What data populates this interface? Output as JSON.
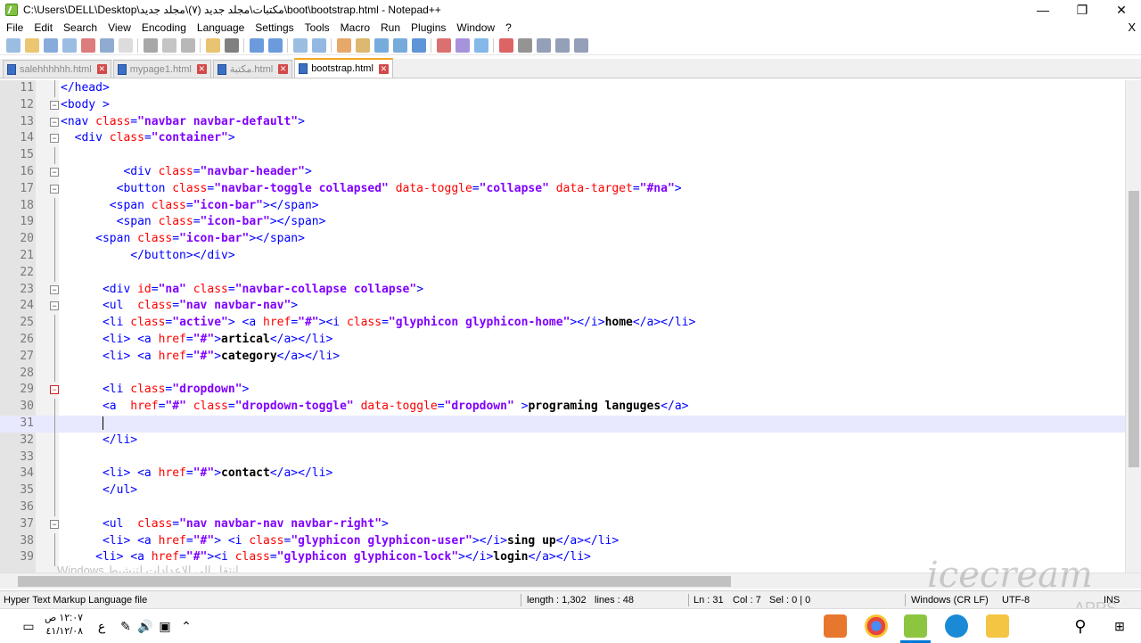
{
  "window": {
    "title": "C:\\Users\\DELL\\Desktop\\مكتبات\\مجلد جديد (٧)\\مجلد جديد\\boot\\bootstrap.html - Notepad++",
    "minimize": "—",
    "maximize": "❐",
    "close": "✕"
  },
  "menu": {
    "items": [
      "File",
      "Edit",
      "Search",
      "View",
      "Encoding",
      "Language",
      "Settings",
      "Tools",
      "Macro",
      "Run",
      "Plugins",
      "Window",
      "?"
    ],
    "close": "X"
  },
  "tabs": [
    {
      "label": "salehhhhhh.html",
      "active": false
    },
    {
      "label": "mypage1.html",
      "active": false
    },
    {
      "label": "مكتبة.html",
      "active": false
    },
    {
      "label": "bootstrap.html",
      "active": true
    }
  ],
  "tab_close": "✕",
  "editor": {
    "lines": [
      {
        "n": "11",
        "fold": "",
        "tokens": [
          [
            "tag",
            "</head>"
          ]
        ]
      },
      {
        "n": "12",
        "fold": "minus",
        "tokens": [
          [
            "tag",
            "<body >"
          ]
        ]
      },
      {
        "n": "13",
        "fold": "minus",
        "tokens": [
          [
            "tag",
            "<nav "
          ],
          [
            "attr",
            "class"
          ],
          [
            "tag",
            "="
          ],
          [
            "str",
            "\"navbar navbar-default\""
          ],
          [
            "tag",
            ">"
          ]
        ]
      },
      {
        "n": "14",
        "fold": "minus",
        "tokens": [
          [
            "tag",
            "  <div "
          ],
          [
            "attr",
            "class"
          ],
          [
            "tag",
            "="
          ],
          [
            "str",
            "\"container\""
          ],
          [
            "tag",
            ">"
          ]
        ]
      },
      {
        "n": "15",
        "fold": "",
        "tokens": []
      },
      {
        "n": "16",
        "fold": "minus",
        "tokens": [
          [
            "tag",
            "         <div "
          ],
          [
            "attr",
            "class"
          ],
          [
            "tag",
            "="
          ],
          [
            "str",
            "\"navbar-header\""
          ],
          [
            "tag",
            ">"
          ]
        ]
      },
      {
        "n": "17",
        "fold": "minus",
        "tokens": [
          [
            "tag",
            "        <button "
          ],
          [
            "attr",
            "class"
          ],
          [
            "tag",
            "="
          ],
          [
            "str",
            "\"navbar-toggle collapsed\""
          ],
          [
            "tag",
            " "
          ],
          [
            "attr",
            "data-toggle"
          ],
          [
            "tag",
            "="
          ],
          [
            "str",
            "\"collapse\""
          ],
          [
            "tag",
            " "
          ],
          [
            "attr",
            "data-target"
          ],
          [
            "tag",
            "="
          ],
          [
            "str",
            "\"#na\""
          ],
          [
            "tag",
            ">"
          ]
        ]
      },
      {
        "n": "18",
        "fold": "",
        "tokens": [
          [
            "tag",
            "       <span "
          ],
          [
            "attr",
            "class"
          ],
          [
            "tag",
            "="
          ],
          [
            "str",
            "\"icon-bar\""
          ],
          [
            "tag",
            "></span>"
          ]
        ]
      },
      {
        "n": "19",
        "fold": "",
        "tokens": [
          [
            "tag",
            "        <span "
          ],
          [
            "attr",
            "class"
          ],
          [
            "tag",
            "="
          ],
          [
            "str",
            "\"icon-bar\""
          ],
          [
            "tag",
            "></span>"
          ]
        ]
      },
      {
        "n": "20",
        "fold": "",
        "tokens": [
          [
            "tag",
            "     <span "
          ],
          [
            "attr",
            "class"
          ],
          [
            "tag",
            "="
          ],
          [
            "str",
            "\"icon-bar\""
          ],
          [
            "tag",
            "></span>"
          ]
        ]
      },
      {
        "n": "21",
        "fold": "",
        "tokens": [
          [
            "tag",
            "          </button></div>"
          ]
        ]
      },
      {
        "n": "22",
        "fold": "",
        "tokens": []
      },
      {
        "n": "23",
        "fold": "minus",
        "tokens": [
          [
            "tag",
            "      <div "
          ],
          [
            "attr",
            "id"
          ],
          [
            "tag",
            "="
          ],
          [
            "str",
            "\"na\""
          ],
          [
            "tag",
            " "
          ],
          [
            "attr",
            "class"
          ],
          [
            "tag",
            "="
          ],
          [
            "str",
            "\"navbar-collapse collapse\""
          ],
          [
            "tag",
            ">"
          ]
        ]
      },
      {
        "n": "24",
        "fold": "minus",
        "tokens": [
          [
            "tag",
            "      <ul  "
          ],
          [
            "attr",
            "class"
          ],
          [
            "tag",
            "="
          ],
          [
            "str",
            "\"nav navbar-nav\""
          ],
          [
            "tag",
            ">"
          ]
        ]
      },
      {
        "n": "25",
        "fold": "",
        "tokens": [
          [
            "tag",
            "      <li "
          ],
          [
            "attr",
            "class"
          ],
          [
            "tag",
            "="
          ],
          [
            "str",
            "\"active\""
          ],
          [
            "tag",
            "> <a "
          ],
          [
            "attr",
            "href"
          ],
          [
            "tag",
            "="
          ],
          [
            "str",
            "\"#\""
          ],
          [
            "tag",
            "><i "
          ],
          [
            "attr",
            "class"
          ],
          [
            "tag",
            "="
          ],
          [
            "str",
            "\"glyphicon glyphicon-home\""
          ],
          [
            "tag",
            "></i>"
          ],
          [
            "txt",
            "home"
          ],
          [
            "tag",
            "</a></li>"
          ]
        ]
      },
      {
        "n": "26",
        "fold": "",
        "tokens": [
          [
            "tag",
            "      <li> <a "
          ],
          [
            "attr",
            "href"
          ],
          [
            "tag",
            "="
          ],
          [
            "str",
            "\"#\""
          ],
          [
            "tag",
            ">"
          ],
          [
            "txt",
            "artical"
          ],
          [
            "tag",
            "</a></li>"
          ]
        ]
      },
      {
        "n": "27",
        "fold": "",
        "tokens": [
          [
            "tag",
            "      <li> <a "
          ],
          [
            "attr",
            "href"
          ],
          [
            "tag",
            "="
          ],
          [
            "str",
            "\"#\""
          ],
          [
            "tag",
            ">"
          ],
          [
            "txt",
            "category"
          ],
          [
            "tag",
            "</a></li>"
          ]
        ]
      },
      {
        "n": "28",
        "fold": "",
        "tokens": []
      },
      {
        "n": "29",
        "fold": "red",
        "tokens": [
          [
            "tag",
            "      <li "
          ],
          [
            "attr",
            "class"
          ],
          [
            "tag",
            "="
          ],
          [
            "str",
            "\"dropdown\""
          ],
          [
            "tag",
            ">"
          ]
        ]
      },
      {
        "n": "30",
        "fold": "",
        "tokens": [
          [
            "tag",
            "      <a  "
          ],
          [
            "attr",
            "href"
          ],
          [
            "tag",
            "="
          ],
          [
            "str",
            "\"#\""
          ],
          [
            "tag",
            " "
          ],
          [
            "attr",
            "class"
          ],
          [
            "tag",
            "="
          ],
          [
            "str",
            "\"dropdown-toggle\""
          ],
          [
            "tag",
            " "
          ],
          [
            "attr",
            "data-toggle"
          ],
          [
            "tag",
            "="
          ],
          [
            "str",
            "\"dropdown\""
          ],
          [
            "tag",
            " >"
          ],
          [
            "txt",
            "programing languges"
          ],
          [
            "tag",
            "</a>"
          ]
        ]
      },
      {
        "n": "31",
        "fold": "",
        "current": true,
        "tokens": [
          [
            "tag",
            "      "
          ]
        ]
      },
      {
        "n": "32",
        "fold": "",
        "tokens": [
          [
            "tag",
            "      </li>"
          ]
        ]
      },
      {
        "n": "33",
        "fold": "",
        "tokens": []
      },
      {
        "n": "34",
        "fold": "",
        "tokens": [
          [
            "tag",
            "      <li> <a "
          ],
          [
            "attr",
            "href"
          ],
          [
            "tag",
            "="
          ],
          [
            "str",
            "\"#\""
          ],
          [
            "tag",
            ">"
          ],
          [
            "txt",
            "contact"
          ],
          [
            "tag",
            "</a></li>"
          ]
        ]
      },
      {
        "n": "35",
        "fold": "",
        "tokens": [
          [
            "tag",
            "      </ul>"
          ]
        ]
      },
      {
        "n": "36",
        "fold": "",
        "tokens": []
      },
      {
        "n": "37",
        "fold": "minus",
        "tokens": [
          [
            "tag",
            "      <ul  "
          ],
          [
            "attr",
            "class"
          ],
          [
            "tag",
            "="
          ],
          [
            "str",
            "\"nav navbar-nav navbar-right\""
          ],
          [
            "tag",
            ">"
          ]
        ]
      },
      {
        "n": "38",
        "fold": "",
        "tokens": [
          [
            "tag",
            "      <li> <a "
          ],
          [
            "attr",
            "href"
          ],
          [
            "tag",
            "="
          ],
          [
            "str",
            "\"#\""
          ],
          [
            "tag",
            "> <i "
          ],
          [
            "attr",
            "class"
          ],
          [
            "tag",
            "="
          ],
          [
            "str",
            "\"glyphicon glyphicon-user\""
          ],
          [
            "tag",
            "></i>"
          ],
          [
            "txt",
            "sing up"
          ],
          [
            "tag",
            "</a></li>"
          ]
        ]
      },
      {
        "n": "39",
        "fold": "",
        "tokens": [
          [
            "tag",
            "     <li> <a "
          ],
          [
            "attr",
            "href"
          ],
          [
            "tag",
            "="
          ],
          [
            "str",
            "\"#\""
          ],
          [
            "tag",
            "><i "
          ],
          [
            "attr",
            "class"
          ],
          [
            "tag",
            "="
          ],
          [
            "str",
            "\"glyphicon glyphicon-lock\""
          ],
          [
            "tag",
            "></i>"
          ],
          [
            "txt",
            "login"
          ],
          [
            "tag",
            "</a></li>"
          ]
        ]
      }
    ]
  },
  "overlay": {
    "activate_windows": "Windows انتقل إلى الإعدادات لتنشيط",
    "watermark": "icecream",
    "watermark_sub": "APPS"
  },
  "status": {
    "file_type": "Hyper Text Markup Language file",
    "length": "length : 1,302",
    "lines": "lines : 48",
    "ln": "Ln : 31",
    "col": "Col : 7",
    "sel": "Sel : 0 | 0",
    "eol": "Windows (CR LF)",
    "encoding": "UTF-8",
    "ins": "INS"
  },
  "taskbar": {
    "time": "١٢:٠٧ ص",
    "date": "٤١/١٢/٠٨",
    "lang": "ع"
  }
}
